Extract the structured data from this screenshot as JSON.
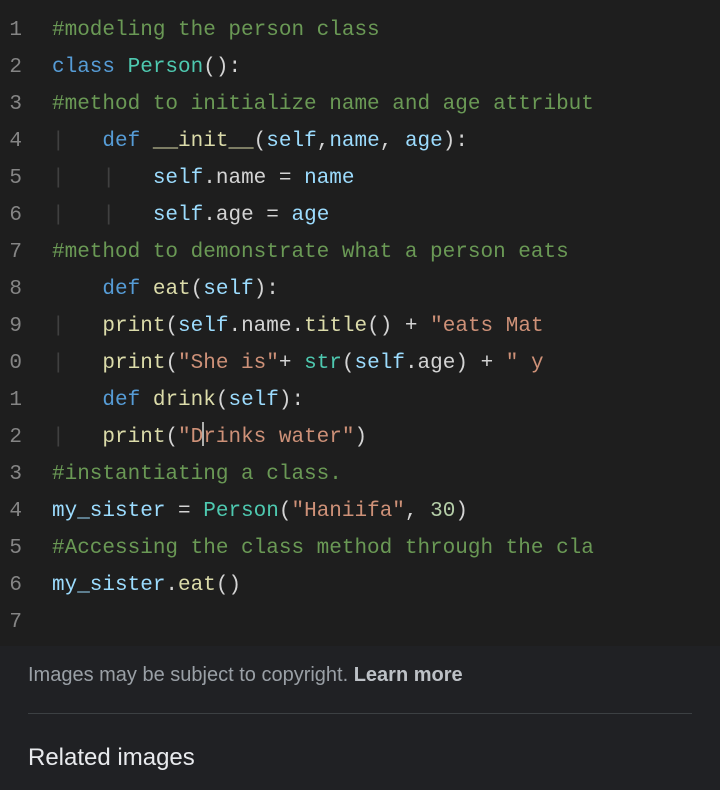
{
  "editor": {
    "line_numbers": [
      "1",
      "2",
      "3",
      "4",
      "5",
      "6",
      "7",
      "8",
      "9",
      "0",
      "1",
      "2",
      "3",
      "4",
      "5",
      "6",
      "7"
    ],
    "lines": [
      {
        "indent": "",
        "tokens": [
          {
            "cls": "tk-comment",
            "t": "#modeling the person class"
          }
        ]
      },
      {
        "indent": "",
        "tokens": [
          {
            "cls": "tk-keyword",
            "t": "class "
          },
          {
            "cls": "tk-class",
            "t": "Person"
          },
          {
            "cls": "tk-punct",
            "t": "():"
          }
        ]
      },
      {
        "indent": "",
        "tokens": [
          {
            "cls": "tk-comment",
            "t": "#method to initialize name and age attribut"
          }
        ]
      },
      {
        "indent": "    ",
        "guide": "|   ",
        "tokens": [
          {
            "cls": "tk-keyword",
            "t": "def "
          },
          {
            "cls": "tk-func",
            "t": "__init__"
          },
          {
            "cls": "tk-punct",
            "t": "("
          },
          {
            "cls": "tk-var",
            "t": "self"
          },
          {
            "cls": "tk-punct",
            "t": ","
          },
          {
            "cls": "tk-var",
            "t": "name"
          },
          {
            "cls": "tk-punct",
            "t": ", "
          },
          {
            "cls": "tk-var",
            "t": "age"
          },
          {
            "cls": "tk-punct",
            "t": "):"
          }
        ]
      },
      {
        "indent": "    ",
        "guide": "|   |   ",
        "tokens": [
          {
            "cls": "tk-var",
            "t": "self"
          },
          {
            "cls": "tk-punct",
            "t": "."
          },
          {
            "cls": "tk-plain",
            "t": "name "
          },
          {
            "cls": "tk-punct",
            "t": "= "
          },
          {
            "cls": "tk-var",
            "t": "name"
          }
        ]
      },
      {
        "indent": "    ",
        "guide": "|   |   ",
        "tokens": [
          {
            "cls": "tk-var",
            "t": "self"
          },
          {
            "cls": "tk-punct",
            "t": "."
          },
          {
            "cls": "tk-plain",
            "t": "age "
          },
          {
            "cls": "tk-punct",
            "t": "= "
          },
          {
            "cls": "tk-var",
            "t": "age"
          }
        ]
      },
      {
        "indent": "",
        "tokens": [
          {
            "cls": "tk-comment",
            "t": "#method to demonstrate what a person eats"
          }
        ]
      },
      {
        "indent": "    ",
        "guide": "",
        "tokens": [
          {
            "cls": "tk-keyword",
            "t": "def "
          },
          {
            "cls": "tk-func",
            "t": "eat"
          },
          {
            "cls": "tk-punct",
            "t": "("
          },
          {
            "cls": "tk-var",
            "t": "self"
          },
          {
            "cls": "tk-punct",
            "t": "):"
          }
        ]
      },
      {
        "indent": "    ",
        "guide": "|   ",
        "tokens": [
          {
            "cls": "tk-func",
            "t": "print"
          },
          {
            "cls": "tk-punct",
            "t": "("
          },
          {
            "cls": "tk-var",
            "t": "self"
          },
          {
            "cls": "tk-punct",
            "t": "."
          },
          {
            "cls": "tk-plain",
            "t": "name"
          },
          {
            "cls": "tk-punct",
            "t": "."
          },
          {
            "cls": "tk-func",
            "t": "title"
          },
          {
            "cls": "tk-punct",
            "t": "() + "
          },
          {
            "cls": "tk-string",
            "t": "\"eats Mat"
          }
        ]
      },
      {
        "indent": "    ",
        "guide": "|   ",
        "tokens": [
          {
            "cls": "tk-func",
            "t": "print"
          },
          {
            "cls": "tk-punct",
            "t": "("
          },
          {
            "cls": "tk-string",
            "t": "\"She is\""
          },
          {
            "cls": "tk-punct",
            "t": "+ "
          },
          {
            "cls": "tk-class",
            "t": "str"
          },
          {
            "cls": "tk-punct",
            "t": "("
          },
          {
            "cls": "tk-var",
            "t": "self"
          },
          {
            "cls": "tk-punct",
            "t": "."
          },
          {
            "cls": "tk-plain",
            "t": "age"
          },
          {
            "cls": "tk-punct",
            "t": ") + "
          },
          {
            "cls": "tk-string",
            "t": "\" y"
          }
        ]
      },
      {
        "indent": "    ",
        "guide": "",
        "tokens": [
          {
            "cls": "tk-keyword",
            "t": "def "
          },
          {
            "cls": "tk-func",
            "t": "drink"
          },
          {
            "cls": "tk-punct",
            "t": "("
          },
          {
            "cls": "tk-var",
            "t": "self"
          },
          {
            "cls": "tk-punct",
            "t": "):"
          }
        ]
      },
      {
        "indent": "    ",
        "guide": "|   ",
        "cursor_at": 2,
        "tokens": [
          {
            "cls": "tk-func",
            "t": "print"
          },
          {
            "cls": "tk-punct",
            "t": "("
          },
          {
            "cls": "tk-string",
            "t": "\"D"
          },
          {
            "cls": "tk-string",
            "t": "rinks water\""
          },
          {
            "cls": "tk-punct",
            "t": ")"
          }
        ]
      },
      {
        "indent": "",
        "tokens": [
          {
            "cls": "tk-comment",
            "t": "#instantiating a class."
          }
        ]
      },
      {
        "indent": "",
        "tokens": [
          {
            "cls": "tk-var",
            "t": "my_sister "
          },
          {
            "cls": "tk-punct",
            "t": "= "
          },
          {
            "cls": "tk-class",
            "t": "Person"
          },
          {
            "cls": "tk-punct",
            "t": "("
          },
          {
            "cls": "tk-string",
            "t": "\"Haniifa\""
          },
          {
            "cls": "tk-punct",
            "t": ", "
          },
          {
            "cls": "tk-num",
            "t": "30"
          },
          {
            "cls": "tk-punct",
            "t": ")"
          }
        ]
      },
      {
        "indent": "",
        "tokens": [
          {
            "cls": "tk-comment",
            "t": "#Accessing the class method through the cla"
          }
        ]
      },
      {
        "indent": "",
        "tokens": [
          {
            "cls": "tk-var",
            "t": "my_sister"
          },
          {
            "cls": "tk-punct",
            "t": "."
          },
          {
            "cls": "tk-func",
            "t": "eat"
          },
          {
            "cls": "tk-punct",
            "t": "()"
          }
        ]
      },
      {
        "indent": "",
        "tokens": []
      }
    ]
  },
  "footer": {
    "copyright_text": "Images may be subject to copyright. ",
    "learn_more": "Learn more",
    "related_heading": "Related images"
  }
}
